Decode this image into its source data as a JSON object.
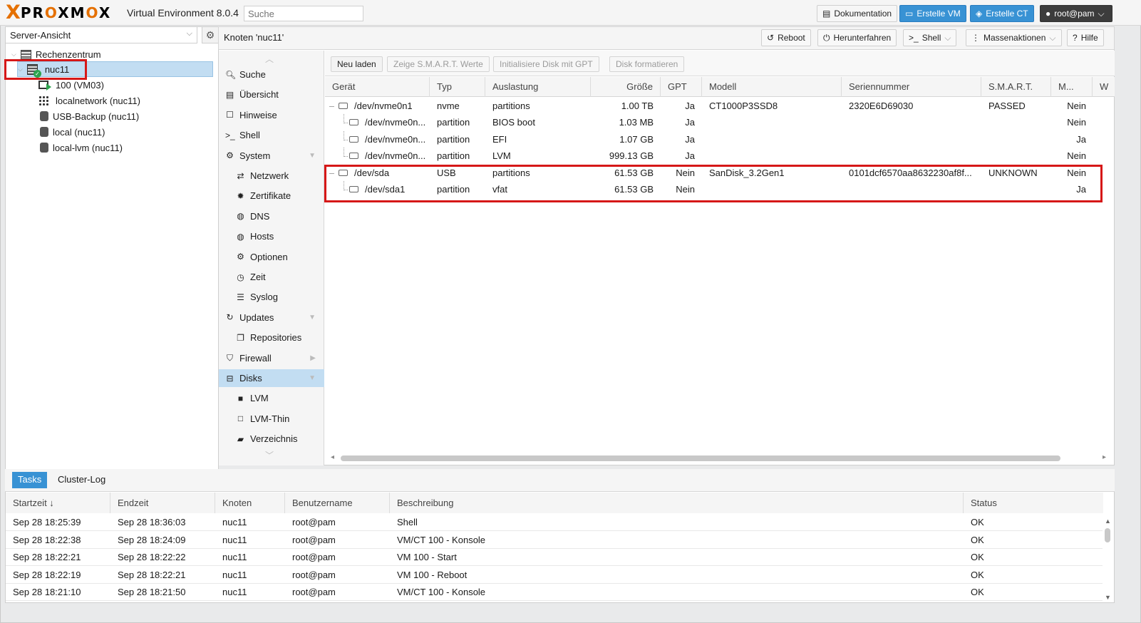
{
  "header": {
    "logo_x": "X",
    "logo_text_a": "PR",
    "logo_text_o1": "O",
    "logo_text_b": "XM",
    "logo_text_o2": "O",
    "logo_text_c": "X",
    "product": "Virtual Environment 8.0.4",
    "search_placeholder": "Suche",
    "buttons": {
      "docs": "Dokumentation",
      "create_vm": "Erstelle VM",
      "create_ct": "Erstelle CT",
      "user": "root@pam"
    }
  },
  "tree": {
    "view_selector": "Server-Ansicht",
    "nodes": [
      {
        "label": "Rechenzentrum",
        "icon": "datacenter-icon"
      },
      {
        "label": "nuc11",
        "icon": "node-online-icon"
      },
      {
        "label": "100 (VM03)",
        "icon": "vm-running-icon"
      },
      {
        "label": "localnetwork (nuc11)",
        "icon": "sdn-icon"
      },
      {
        "label": "USB-Backup (nuc11)",
        "icon": "storage-icon"
      },
      {
        "label": "local (nuc11)",
        "icon": "storage-icon"
      },
      {
        "label": "local-lvm (nuc11)",
        "icon": "storage-icon"
      }
    ]
  },
  "content": {
    "title": "Knoten 'nuc11'",
    "buttons": {
      "reboot": "Reboot",
      "shutdown": "Herunterfahren",
      "shell": "Shell",
      "bulk": "Massenaktionen",
      "help": "Hilfe"
    }
  },
  "menu": [
    {
      "label": "Suche",
      "icon": "search-icon",
      "sub": false
    },
    {
      "label": "Übersicht",
      "icon": "book-icon",
      "sub": false
    },
    {
      "label": "Hinweise",
      "icon": "note-icon",
      "sub": false
    },
    {
      "label": "Shell",
      "icon": "terminal-icon",
      "sub": false
    },
    {
      "label": "System",
      "icon": "gears-icon",
      "sub": false,
      "expand": "down"
    },
    {
      "label": "Netzwerk",
      "icon": "exchange-icon",
      "sub": true
    },
    {
      "label": "Zertifikate",
      "icon": "certificate-icon",
      "sub": true
    },
    {
      "label": "DNS",
      "icon": "globe-icon",
      "sub": true
    },
    {
      "label": "Hosts",
      "icon": "globe-icon",
      "sub": true
    },
    {
      "label": "Optionen",
      "icon": "gear-icon",
      "sub": true
    },
    {
      "label": "Zeit",
      "icon": "clock-icon",
      "sub": true
    },
    {
      "label": "Syslog",
      "icon": "list-icon",
      "sub": true
    },
    {
      "label": "Updates",
      "icon": "refresh-icon",
      "sub": false,
      "expand": "down"
    },
    {
      "label": "Repositories",
      "icon": "files-icon",
      "sub": true
    },
    {
      "label": "Firewall",
      "icon": "shield-icon",
      "sub": false,
      "expand": "right"
    },
    {
      "label": "Disks",
      "icon": "hdd-icon",
      "sub": false,
      "expand": "down",
      "active": true
    },
    {
      "label": "LVM",
      "icon": "square-icon",
      "sub": true
    },
    {
      "label": "LVM-Thin",
      "icon": "square-outline-icon",
      "sub": true
    },
    {
      "label": "Verzeichnis",
      "icon": "folder-icon",
      "sub": true
    }
  ],
  "disk_toolbar": {
    "reload": "Neu laden",
    "smart": "Zeige S.M.A.R.T. Werte",
    "init_gpt": "Initialisiere Disk mit GPT",
    "format": "Disk formatieren"
  },
  "disk_columns": [
    "Gerät",
    "Typ",
    "Auslastung",
    "Größe",
    "GPT",
    "Modell",
    "Seriennummer",
    "S.M.A.R.T.",
    "M...",
    "W"
  ],
  "disks": [
    {
      "device": "/dev/nvme0n1",
      "type": "nvme",
      "usage": "partitions",
      "size": "1.00 TB",
      "gpt": "Ja",
      "model": "CT1000P3SSD8",
      "serial": "2320E6D69030",
      "smart": "PASSED",
      "mounted": "Nein",
      "child": false
    },
    {
      "device": "/dev/nvme0n...",
      "type": "partition",
      "usage": "BIOS boot",
      "size": "1.03 MB",
      "gpt": "Ja",
      "model": "",
      "serial": "",
      "smart": "",
      "mounted": "Nein",
      "child": true
    },
    {
      "device": "/dev/nvme0n...",
      "type": "partition",
      "usage": "EFI",
      "size": "1.07 GB",
      "gpt": "Ja",
      "model": "",
      "serial": "",
      "smart": "",
      "mounted": "Ja",
      "child": true
    },
    {
      "device": "/dev/nvme0n...",
      "type": "partition",
      "usage": "LVM",
      "size": "999.13 GB",
      "gpt": "Ja",
      "model": "",
      "serial": "",
      "smart": "",
      "mounted": "Nein",
      "child": true
    },
    {
      "device": "/dev/sda",
      "type": "USB",
      "usage": "partitions",
      "size": "61.53 GB",
      "gpt": "Nein",
      "model": "SanDisk_3.2Gen1",
      "serial": "0101dcf6570aa8632230af8f...",
      "smart": "UNKNOWN",
      "mounted": "Nein",
      "child": false
    },
    {
      "device": "/dev/sda1",
      "type": "partition",
      "usage": "vfat",
      "size": "61.53 GB",
      "gpt": "Nein",
      "model": "",
      "serial": "",
      "smart": "",
      "mounted": "Ja",
      "child": true
    }
  ],
  "tasks": {
    "tabs": [
      "Tasks",
      "Cluster-Log"
    ],
    "columns": [
      "Startzeit ↓",
      "Endzeit",
      "Knoten",
      "Benutzername",
      "Beschreibung",
      "Status"
    ],
    "rows": [
      [
        "Sep 28 18:25:39",
        "Sep 28 18:36:03",
        "nuc11",
        "root@pam",
        "Shell",
        "OK"
      ],
      [
        "Sep 28 18:22:38",
        "Sep 28 18:24:09",
        "nuc11",
        "root@pam",
        "VM/CT 100 - Konsole",
        "OK"
      ],
      [
        "Sep 28 18:22:21",
        "Sep 28 18:22:22",
        "nuc11",
        "root@pam",
        "VM 100 - Start",
        "OK"
      ],
      [
        "Sep 28 18:22:19",
        "Sep 28 18:22:21",
        "nuc11",
        "root@pam",
        "VM 100 - Reboot",
        "OK"
      ],
      [
        "Sep 28 18:21:10",
        "Sep 28 18:21:50",
        "nuc11",
        "root@pam",
        "VM/CT 100 - Konsole",
        "OK"
      ]
    ]
  }
}
